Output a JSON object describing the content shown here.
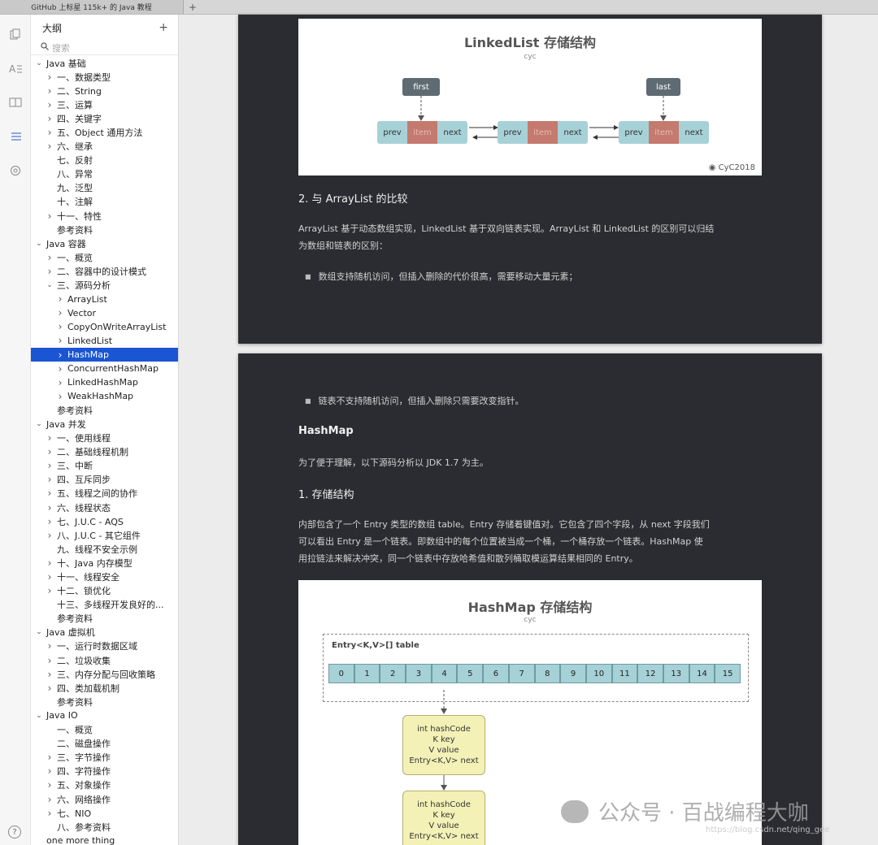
{
  "tab": {
    "title": "GitHub 上标星 115k+ 的 Java 教程",
    "add": "+"
  },
  "rail_icons": [
    "files-icon",
    "font-icon",
    "book-icon",
    "outline-icon",
    "tag-icon"
  ],
  "outline": {
    "title": "大纲",
    "add": "+",
    "search_placeholder": "搜索",
    "help": "?",
    "items": [
      {
        "label": "Java 基础",
        "level": 0,
        "arrow": "v"
      },
      {
        "label": "一、数据类型",
        "level": 1,
        "arrow": ">"
      },
      {
        "label": "二、String",
        "level": 1,
        "arrow": ">"
      },
      {
        "label": "三、运算",
        "level": 1,
        "arrow": ">"
      },
      {
        "label": "四、关键字",
        "level": 1,
        "arrow": ">"
      },
      {
        "label": "五、Object 通用方法",
        "level": 1,
        "arrow": ">"
      },
      {
        "label": "六、继承",
        "level": 1,
        "arrow": ">"
      },
      {
        "label": "七、反射",
        "level": 1,
        "arrow": ""
      },
      {
        "label": "八、异常",
        "level": 1,
        "arrow": ""
      },
      {
        "label": "九、泛型",
        "level": 1,
        "arrow": ""
      },
      {
        "label": "十、注解",
        "level": 1,
        "arrow": ""
      },
      {
        "label": "十一、特性",
        "level": 1,
        "arrow": ">"
      },
      {
        "label": "参考资料",
        "level": 1,
        "arrow": ""
      },
      {
        "label": "Java 容器",
        "level": 0,
        "arrow": "v"
      },
      {
        "label": "一、概览",
        "level": 1,
        "arrow": ">"
      },
      {
        "label": "二、容器中的设计模式",
        "level": 1,
        "arrow": ">"
      },
      {
        "label": "三、源码分析",
        "level": 1,
        "arrow": "v"
      },
      {
        "label": "ArrayList",
        "level": 2,
        "arrow": ">"
      },
      {
        "label": "Vector",
        "level": 2,
        "arrow": ">"
      },
      {
        "label": "CopyOnWriteArrayList",
        "level": 2,
        "arrow": ">"
      },
      {
        "label": "LinkedList",
        "level": 2,
        "arrow": ">"
      },
      {
        "label": "HashMap",
        "level": 2,
        "arrow": ">",
        "selected": true
      },
      {
        "label": "ConcurrentHashMap",
        "level": 2,
        "arrow": ">"
      },
      {
        "label": "LinkedHashMap",
        "level": 2,
        "arrow": ">"
      },
      {
        "label": "WeakHashMap",
        "level": 2,
        "arrow": ">"
      },
      {
        "label": "参考资料",
        "level": 1,
        "arrow": ""
      },
      {
        "label": "Java 并发",
        "level": 0,
        "arrow": "v"
      },
      {
        "label": "一、使用线程",
        "level": 1,
        "arrow": ">"
      },
      {
        "label": "二、基础线程机制",
        "level": 1,
        "arrow": ">"
      },
      {
        "label": "三、中断",
        "level": 1,
        "arrow": ">"
      },
      {
        "label": "四、互斥同步",
        "level": 1,
        "arrow": ">"
      },
      {
        "label": "五、线程之间的协作",
        "level": 1,
        "arrow": ">"
      },
      {
        "label": "六、线程状态",
        "level": 1,
        "arrow": ">"
      },
      {
        "label": "七、J.U.C - AQS",
        "level": 1,
        "arrow": ">"
      },
      {
        "label": "八、J.U.C - 其它组件",
        "level": 1,
        "arrow": ">"
      },
      {
        "label": "九、线程不安全示例",
        "level": 1,
        "arrow": ""
      },
      {
        "label": "十、Java 内存模型",
        "level": 1,
        "arrow": ">"
      },
      {
        "label": "十一、线程安全",
        "level": 1,
        "arrow": ">"
      },
      {
        "label": "十二、锁优化",
        "level": 1,
        "arrow": ">"
      },
      {
        "label": "十三、多线程开发良好的...",
        "level": 1,
        "arrow": ""
      },
      {
        "label": "参考资料",
        "level": 1,
        "arrow": ""
      },
      {
        "label": "Java 虚拟机",
        "level": 0,
        "arrow": "v"
      },
      {
        "label": "一、运行时数据区域",
        "level": 1,
        "arrow": ">"
      },
      {
        "label": "二、垃圾收集",
        "level": 1,
        "arrow": ">"
      },
      {
        "label": "三、内存分配与回收策略",
        "level": 1,
        "arrow": ">"
      },
      {
        "label": "四、类加载机制",
        "level": 1,
        "arrow": ">"
      },
      {
        "label": "参考资料",
        "level": 1,
        "arrow": ""
      },
      {
        "label": "Java IO",
        "level": 0,
        "arrow": "v"
      },
      {
        "label": "一、概览",
        "level": 1,
        "arrow": ""
      },
      {
        "label": "二、磁盘操作",
        "level": 1,
        "arrow": ""
      },
      {
        "label": "三、字节操作",
        "level": 1,
        "arrow": ">"
      },
      {
        "label": "四、字符操作",
        "level": 1,
        "arrow": ">"
      },
      {
        "label": "五、对象操作",
        "level": 1,
        "arrow": ">"
      },
      {
        "label": "六、网络操作",
        "level": 1,
        "arrow": ">"
      },
      {
        "label": "七、NIO",
        "level": 1,
        "arrow": ">"
      },
      {
        "label": "八、参考资料",
        "level": 1,
        "arrow": ""
      },
      {
        "label": "one more thing",
        "level": 0,
        "arrow": ""
      }
    ]
  },
  "page1": {
    "figure": {
      "title": "LinkedList 存储结构",
      "subtitle": "cyc",
      "first_label": "first",
      "last_label": "last",
      "prev": "prev",
      "item": "item",
      "next": "next",
      "watermark": "CyC2018"
    },
    "heading": "2. 与 ArrayList 的比较",
    "para_line1": "ArrayList 基于动态数组实现，LinkedList 基于双向链表实现。ArrayList 和 LinkedList 的区别可以归结",
    "para_line2": "为数组和链表的区别：",
    "bullet": "数组支持随机访问，但插入删除的代价很高，需要移动大量元素；"
  },
  "page2": {
    "bullet": "链表不支持随机访问，但插入删除只需要改变指针。",
    "heading_hashmap": "HashMap",
    "intro": "为了便于理解，以下源码分析以 JDK 1.7 为主。",
    "heading_storage": "1. 存储结构",
    "para_line1": "内部包含了一个 Entry 类型的数组 table。Entry 存储着键值对。它包含了四个字段，从 next 字段我们",
    "para_line2": "可以看出 Entry 是一个链表。即数组中的每个位置被当成一个桶，一个桶存放一个链表。HashMap 使",
    "para_line3": "用拉链法来解决冲突，同一个链表中存放哈希值和散列桶取模运算结果相同的 Entry。",
    "figure": {
      "title": "HashMap 存储结构",
      "subtitle": "cyc",
      "table_label": "Entry<K,V>[] table",
      "cells": [
        "0",
        "1",
        "2",
        "3",
        "4",
        "5",
        "6",
        "7",
        "8",
        "9",
        "10",
        "11",
        "12",
        "13",
        "14",
        "15"
      ],
      "entry_lines": [
        "int hashCode",
        "K key",
        "V value",
        "Entry<K,V> next"
      ]
    }
  },
  "watermark": {
    "wechat": "公众号 · 百战编程大咖",
    "url": "https://blog.csdn.net/qing_gee"
  }
}
